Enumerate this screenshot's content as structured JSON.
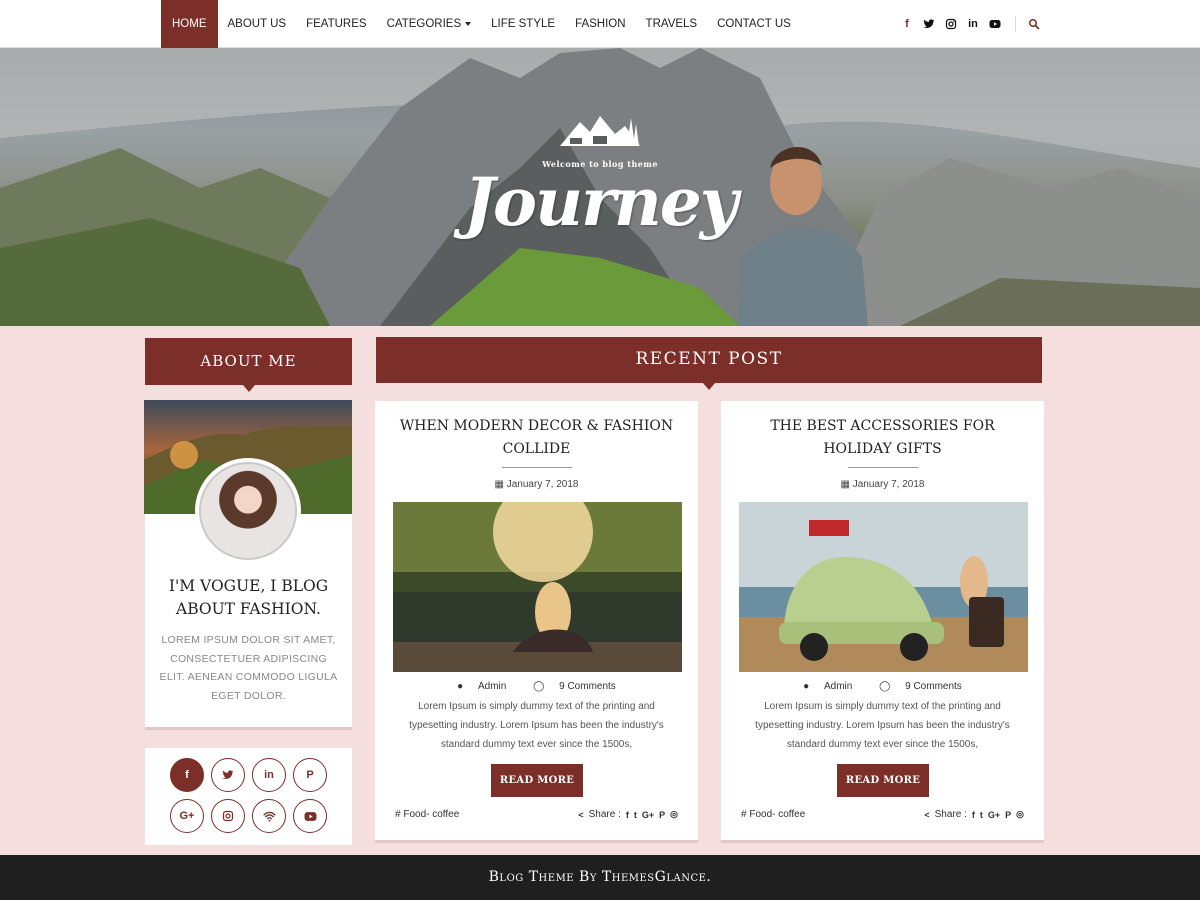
{
  "nav": {
    "items": [
      {
        "label": "HOME"
      },
      {
        "label": "ABOUT US"
      },
      {
        "label": "FEATURES"
      },
      {
        "label": "CATEGORIES"
      },
      {
        "label": "LIFE STYLE"
      },
      {
        "label": "FASHION"
      },
      {
        "label": "TRAVELS"
      },
      {
        "label": "CONTACT US"
      }
    ],
    "social_icons": [
      "facebook-icon",
      "twitter-icon",
      "instagram-icon",
      "linkedin-icon",
      "youtube-icon"
    ],
    "search_icon": "search-icon"
  },
  "hero": {
    "welcome": "Welcome to blog theme",
    "title": "Journey"
  },
  "about": {
    "heading": "ABOUT ME",
    "title": "I'M VOGUE, I BLOG ABOUT FASHION.",
    "text": "LOREM IPSUM DOLOR SIT AMET, CONSECTETUER ADIPISCING ELIT. AENEAN COMMODO LIGULA EGET DOLOR.",
    "social_icons": [
      "facebook-icon",
      "twitter-icon",
      "linkedin-icon",
      "pinterest-icon",
      "google-plus-icon",
      "instagram-icon",
      "wifi-icon",
      "youtube-icon"
    ]
  },
  "recent": {
    "heading": "RECENT POST",
    "posts": [
      {
        "title": "WHEN MODERN DECOR & FASHION COLLIDE",
        "date": "January 7, 2018",
        "author": "Admin",
        "comments": "9 Comments",
        "body": "Lorem Ipsum is simply dummy text of the printing and typesetting industry. Lorem Ipsum has been the industry's standard dummy text ever since the 1500s,",
        "button": "READ MORE",
        "category": "Food- coffee",
        "share_label": "Share :"
      },
      {
        "title": "THE BEST ACCESSORIES FOR HOLIDAY GIFTS",
        "date": "January 7, 2018",
        "author": "Admin",
        "comments": "9 Comments",
        "body": "Lorem Ipsum is simply dummy text of the printing and typesetting industry. Lorem Ipsum has been the industry's standard dummy text ever since the 1500s,",
        "button": "READ MORE",
        "category": "Food- coffee",
        "share_label": "Share :"
      }
    ]
  },
  "footer": {
    "text": "Blog Theme By ThemesGlance."
  },
  "colors": {
    "accent": "#7c2e28",
    "page_bg": "#f4dede",
    "footer_bg": "#1f1f1f"
  }
}
